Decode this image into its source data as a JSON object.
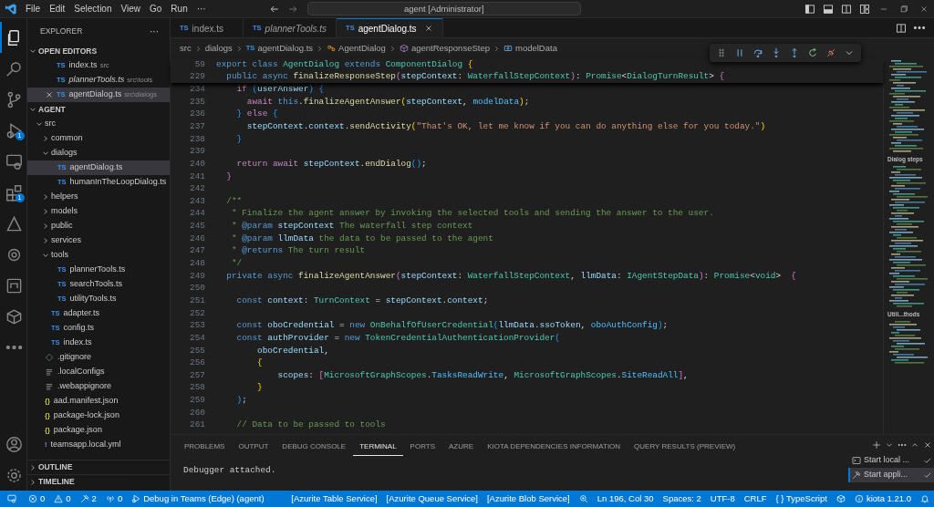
{
  "title_bar": {
    "menu": [
      "File",
      "Edit",
      "Selection",
      "View",
      "Go",
      "Run",
      "···"
    ],
    "command_center": "agent [Administrator]"
  },
  "activity_bar": {
    "top": [
      {
        "kind": "files",
        "selected": true
      },
      {
        "kind": "search",
        "selected": false
      },
      {
        "kind": "branch",
        "selected": false
      },
      {
        "kind": "debug",
        "selected": false,
        "badge": "1"
      },
      {
        "kind": "remote",
        "selected": false
      },
      {
        "kind": "extensions",
        "selected": false,
        "badge": "1"
      },
      {
        "kind": "azure",
        "selected": false
      },
      {
        "kind": "teams",
        "selected": false
      },
      {
        "kind": "m365",
        "selected": false
      },
      {
        "kind": "box",
        "selected": false
      },
      {
        "kind": "more",
        "selected": false
      }
    ],
    "bottom": [
      {
        "kind": "account",
        "selected": false
      },
      {
        "kind": "settings",
        "selected": false
      }
    ]
  },
  "sidebar": {
    "title": "EXPLORER",
    "actions": "···",
    "open_editors": {
      "label": "OPEN EDITORS",
      "expanded": true,
      "items": [
        {
          "glyph": "TS",
          "kind": "ts",
          "name": "index.ts",
          "detail": "src",
          "preview": false,
          "selected": false
        },
        {
          "glyph": "TS",
          "kind": "ts",
          "name": "plannerTools.ts",
          "detail": "src\\tools",
          "preview": true,
          "selected": false
        },
        {
          "glyph": "TS",
          "kind": "ts",
          "name": "agentDialog.ts",
          "detail": "src\\dialogs",
          "preview": false,
          "selected": true
        }
      ]
    },
    "folder": {
      "label": "AGENT",
      "expanded": true,
      "children": [
        {
          "name": "src",
          "expanded": true,
          "children": [
            {
              "name": "common",
              "expanded": false
            },
            {
              "name": "dialogs",
              "expanded": true,
              "children": [
                {
                  "glyph": "TS",
                  "kind": "ts",
                  "name": "agentDialog.ts",
                  "selected": true
                },
                {
                  "glyph": "TS",
                  "kind": "ts",
                  "name": "humanInTheLoopDialog.ts",
                  "selected": false
                }
              ]
            },
            {
              "name": "helpers",
              "expanded": false
            },
            {
              "name": "models",
              "expanded": false
            },
            {
              "name": "public",
              "expanded": false
            },
            {
              "name": "services",
              "expanded": false
            },
            {
              "name": "tools",
              "expanded": true,
              "children": [
                {
                  "glyph": "TS",
                  "kind": "ts",
                  "name": "plannerTools.ts",
                  "selected": false
                },
                {
                  "glyph": "TS",
                  "kind": "ts",
                  "name": "searchTools.ts",
                  "selected": false
                },
                {
                  "glyph": "TS",
                  "kind": "ts",
                  "name": "utilityTools.ts",
                  "selected": false
                }
              ]
            },
            {
              "glyph": "TS",
              "kind": "ts",
              "name": "adapter.ts",
              "selected": false
            },
            {
              "glyph": "TS",
              "kind": "ts",
              "name": "config.ts",
              "selected": false
            },
            {
              "glyph": "TS",
              "kind": "ts",
              "name": "index.ts",
              "selected": false
            }
          ]
        },
        {
          "kind": "git",
          "name": ".gitignore",
          "selected": false
        },
        {
          "kind": "config",
          "name": ".localConfigs",
          "selected": false
        },
        {
          "kind": "config",
          "name": ".webappignore",
          "selected": false
        },
        {
          "glyph": "{}",
          "kind": "json",
          "name": "aad.manifest.json",
          "selected": false
        },
        {
          "glyph": "{}",
          "kind": "json",
          "name": "package-lock.json",
          "selected": false
        },
        {
          "glyph": "{}",
          "kind": "json",
          "name": "package.json",
          "selected": false
        },
        {
          "glyph": "!",
          "kind": "yml",
          "name": "teamsapp.local.yml",
          "selected": false
        }
      ]
    },
    "collapsed_sections": [
      {
        "label": "OUTLINE",
        "expanded": false
      },
      {
        "label": "TIMELINE",
        "expanded": false
      }
    ]
  },
  "editor_tabs": [
    {
      "glyph": "TS",
      "name": "index.ts",
      "preview": false,
      "selected": false
    },
    {
      "glyph": "TS",
      "name": "plannerTools.ts",
      "preview": true,
      "selected": false
    },
    {
      "glyph": "TS",
      "name": "agentDialog.ts",
      "preview": false,
      "selected": true
    }
  ],
  "breadcrumb": [
    {
      "text": "src"
    },
    {
      "text": "dialogs"
    },
    {
      "glyph": "TS",
      "text": "agentDialog.ts"
    },
    {
      "kind": "class",
      "text": "AgentDialog"
    },
    {
      "kind": "method",
      "text": "agentResponseStep"
    },
    {
      "kind": "variable",
      "text": "modelData"
    }
  ],
  "editor": {
    "sticky": [
      {
        "n": "59",
        "tokens": [
          {
            "text": "export ",
            "kind": "kw"
          },
          {
            "text": "class ",
            "kind": "kw"
          },
          {
            "text": "AgentDialog ",
            "kind": "type"
          },
          {
            "text": "extends ",
            "kind": "kw"
          },
          {
            "text": "ComponentDialog ",
            "kind": "type"
          },
          {
            "text": "{",
            "kind": "b1"
          }
        ]
      },
      {
        "n": "229",
        "tokens": [
          {
            "text": "  public async ",
            "kind": "kw"
          },
          {
            "text": "finalizeResponseStep",
            "kind": "fn"
          },
          {
            "text": "(",
            "kind": "b2"
          },
          {
            "text": "stepContext",
            "kind": "var"
          },
          {
            "text": ": ",
            "kind": "punc"
          },
          {
            "text": "WaterfallStepContext",
            "kind": "type"
          },
          {
            "text": ")",
            "kind": "b2"
          },
          {
            "text": ": ",
            "kind": "punc"
          },
          {
            "text": "Promise",
            "kind": "type"
          },
          {
            "text": "<",
            "kind": "punc"
          },
          {
            "text": "DialogTurnResult",
            "kind": "type"
          },
          {
            "text": "> ",
            "kind": "punc"
          },
          {
            "text": "{",
            "kind": "b2"
          }
        ]
      }
    ],
    "lines": [
      {
        "n": "234",
        "tokens": [
          {
            "text": "    if ",
            "kind": "ctl"
          },
          {
            "text": "(",
            "kind": "b3"
          },
          {
            "text": "userAnswer",
            "kind": "var"
          },
          {
            "text": ") ",
            "kind": "b3"
          },
          {
            "text": "{",
            "kind": "b3"
          }
        ]
      },
      {
        "n": "235",
        "tokens": [
          {
            "text": "      await ",
            "kind": "ctl"
          },
          {
            "text": "this",
            "kind": "kw"
          },
          {
            "text": ".",
            "kind": "punc"
          },
          {
            "text": "finalizeAgentAnswer",
            "kind": "fn"
          },
          {
            "text": "(",
            "kind": "b1"
          },
          {
            "text": "stepContext",
            "kind": "var"
          },
          {
            "text": ", ",
            "kind": "punc"
          },
          {
            "text": "modelData",
            "kind": "const"
          },
          {
            "text": ")",
            "kind": "b1"
          },
          {
            "text": ";",
            "kind": "punc"
          }
        ]
      },
      {
        "n": "236",
        "tokens": [
          {
            "text": "    } ",
            "kind": "b3"
          },
          {
            "text": "else ",
            "kind": "ctl"
          },
          {
            "text": "{",
            "kind": "b3"
          }
        ]
      },
      {
        "n": "237",
        "tokens": [
          {
            "text": "      stepContext",
            "kind": "var"
          },
          {
            "text": ".",
            "kind": "punc"
          },
          {
            "text": "context",
            "kind": "var"
          },
          {
            "text": ".",
            "kind": "punc"
          },
          {
            "text": "sendActivity",
            "kind": "fn"
          },
          {
            "text": "(",
            "kind": "b1"
          },
          {
            "text": "\"That's OK, let me know if you can do anything else for you today.\"",
            "kind": "str"
          },
          {
            "text": ")",
            "kind": "b1"
          }
        ]
      },
      {
        "n": "238",
        "tokens": [
          {
            "text": "    }",
            "kind": "b3"
          }
        ]
      },
      {
        "n": "239"
      },
      {
        "n": "240",
        "tokens": [
          {
            "text": "    return await ",
            "kind": "ctl"
          },
          {
            "text": "stepContext",
            "kind": "var"
          },
          {
            "text": ".",
            "kind": "punc"
          },
          {
            "text": "endDialog",
            "kind": "fn"
          },
          {
            "text": "()",
            "kind": "b3"
          },
          {
            "text": ";",
            "kind": "punc"
          }
        ]
      },
      {
        "n": "241",
        "tokens": [
          {
            "text": "  }",
            "kind": "b2"
          }
        ]
      },
      {
        "n": "242"
      },
      {
        "n": "243",
        "tokens": [
          {
            "text": "  /**",
            "kind": "cmt"
          }
        ]
      },
      {
        "n": "244",
        "tokens": [
          {
            "text": "   * Finalize the agent answer by invoking the selected tools and sending the answer to the user.",
            "kind": "cmt"
          }
        ]
      },
      {
        "n": "245",
        "tokens": [
          {
            "text": "   * ",
            "kind": "cmt"
          },
          {
            "text": "@param ",
            "kind": "kw"
          },
          {
            "text": "stepContext ",
            "kind": "var"
          },
          {
            "text": "The waterfall step context",
            "kind": "cmt"
          }
        ]
      },
      {
        "n": "246",
        "tokens": [
          {
            "text": "   * ",
            "kind": "cmt"
          },
          {
            "text": "@param ",
            "kind": "kw"
          },
          {
            "text": "llmData ",
            "kind": "var"
          },
          {
            "text": "the data to be passed to the agent",
            "kind": "cmt"
          }
        ]
      },
      {
        "n": "247",
        "tokens": [
          {
            "text": "   * ",
            "kind": "cmt"
          },
          {
            "text": "@returns ",
            "kind": "kw"
          },
          {
            "text": "The turn result",
            "kind": "cmt"
          }
        ]
      },
      {
        "n": "248",
        "tokens": [
          {
            "text": "   */",
            "kind": "cmt"
          }
        ]
      },
      {
        "n": "249",
        "tokens": [
          {
            "text": "  private async ",
            "kind": "kw"
          },
          {
            "text": "finalizeAgentAnswer",
            "kind": "fn"
          },
          {
            "text": "(",
            "kind": "b2"
          },
          {
            "text": "stepContext",
            "kind": "var"
          },
          {
            "text": ": ",
            "kind": "punc"
          },
          {
            "text": "WaterfallStepContext",
            "kind": "type"
          },
          {
            "text": ", ",
            "kind": "punc"
          },
          {
            "text": "llmData",
            "kind": "var"
          },
          {
            "text": ": ",
            "kind": "punc"
          },
          {
            "text": "IAgentStepData",
            "kind": "type"
          },
          {
            "text": ")",
            "kind": "b2"
          },
          {
            "text": ": ",
            "kind": "punc"
          },
          {
            "text": "Promise",
            "kind": "type"
          },
          {
            "text": "<",
            "kind": "punc"
          },
          {
            "text": "void",
            "kind": "type"
          },
          {
            "text": ">  ",
            "kind": "punc"
          },
          {
            "text": "{",
            "kind": "b2"
          }
        ]
      },
      {
        "n": "250"
      },
      {
        "n": "251",
        "tokens": [
          {
            "text": "    const ",
            "kind": "kw"
          },
          {
            "text": "context",
            "kind": "var"
          },
          {
            "text": ": ",
            "kind": "punc"
          },
          {
            "text": "TurnContext",
            "kind": "type"
          },
          {
            "text": " = ",
            "kind": "punc"
          },
          {
            "text": "stepContext",
            "kind": "var"
          },
          {
            "text": ".",
            "kind": "punc"
          },
          {
            "text": "context",
            "kind": "var"
          },
          {
            "text": ";",
            "kind": "punc"
          }
        ]
      },
      {
        "n": "252"
      },
      {
        "n": "253",
        "tokens": [
          {
            "text": "    const ",
            "kind": "kw"
          },
          {
            "text": "oboCredential",
            "kind": "var"
          },
          {
            "text": " = ",
            "kind": "punc"
          },
          {
            "text": "new ",
            "kind": "kw"
          },
          {
            "text": "OnBehalfOfUserCredential",
            "kind": "type"
          },
          {
            "text": "(",
            "kind": "b3"
          },
          {
            "text": "llmData",
            "kind": "var"
          },
          {
            "text": ".",
            "kind": "punc"
          },
          {
            "text": "ssoToken",
            "kind": "var"
          },
          {
            "text": ", ",
            "kind": "punc"
          },
          {
            "text": "oboAuthConfig",
            "kind": "const"
          },
          {
            "text": ")",
            "kind": "b3"
          },
          {
            "text": ";",
            "kind": "punc"
          }
        ]
      },
      {
        "n": "254",
        "tokens": [
          {
            "text": "    const ",
            "kind": "kw"
          },
          {
            "text": "authProvider",
            "kind": "var"
          },
          {
            "text": " = ",
            "kind": "punc"
          },
          {
            "text": "new ",
            "kind": "kw"
          },
          {
            "text": "TokenCredentialAuthenticationProvider",
            "kind": "type"
          },
          {
            "text": "(",
            "kind": "b3"
          }
        ]
      },
      {
        "n": "255",
        "tokens": [
          {
            "text": "        oboCredential",
            "kind": "var"
          },
          {
            "text": ",",
            "kind": "punc"
          }
        ]
      },
      {
        "n": "256",
        "tokens": [
          {
            "text": "        {",
            "kind": "b1"
          }
        ]
      },
      {
        "n": "257",
        "tokens": [
          {
            "text": "            scopes",
            "kind": "var"
          },
          {
            "text": ": ",
            "kind": "punc"
          },
          {
            "text": "[",
            "kind": "b2"
          },
          {
            "text": "MicrosoftGraphScopes",
            "kind": "type"
          },
          {
            "text": ".",
            "kind": "punc"
          },
          {
            "text": "TasksReadWrite",
            "kind": "const"
          },
          {
            "text": ", ",
            "kind": "punc"
          },
          {
            "text": "MicrosoftGraphScopes",
            "kind": "type"
          },
          {
            "text": ".",
            "kind": "punc"
          },
          {
            "text": "SiteReadAll",
            "kind": "const"
          },
          {
            "text": "]",
            "kind": "b2"
          },
          {
            "text": ",",
            "kind": "punc"
          }
        ]
      },
      {
        "n": "258",
        "tokens": [
          {
            "text": "        }",
            "kind": "b1"
          }
        ]
      },
      {
        "n": "259",
        "tokens": [
          {
            "text": "    )",
            "kind": "b3"
          },
          {
            "text": ";",
            "kind": "punc"
          }
        ]
      },
      {
        "n": "260"
      },
      {
        "n": "261",
        "tokens": [
          {
            "text": "    // Data to be passed to tools",
            "kind": "cmt"
          }
        ]
      }
    ]
  },
  "minimap": {
    "sections": [
      "Dialog steps",
      "Utili...thods"
    ]
  },
  "panel": {
    "tabs": [
      {
        "label": "PROBLEMS",
        "selected": false
      },
      {
        "label": "OUTPUT",
        "selected": false
      },
      {
        "label": "DEBUG CONSOLE",
        "selected": false
      },
      {
        "label": "TERMINAL",
        "selected": true
      },
      {
        "label": "PORTS",
        "selected": false
      },
      {
        "label": "AZURE",
        "selected": false
      },
      {
        "label": "KIOTA DEPENDENCIES INFORMATION",
        "selected": false
      },
      {
        "label": "QUERY RESULTS (PREVIEW)",
        "selected": false
      }
    ],
    "terminal_output": "Debugger attached.",
    "terminals": [
      {
        "kind": "terminal",
        "text": "Start local ...",
        "selected": false
      },
      {
        "kind": "tools",
        "text": "Start appli...",
        "selected": true
      }
    ]
  },
  "status_bar": {
    "left": [
      {
        "kind": "remote"
      },
      {
        "kind": "error",
        "text": "0"
      },
      {
        "kind": "warning",
        "text": "0"
      },
      {
        "kind": "tools",
        "text": "2"
      },
      {
        "kind": "broadcast",
        "text": "0"
      },
      {
        "kind": "debug",
        "text": "Debug in Teams (Edge) (agent)"
      }
    ],
    "right": [
      {
        "text": "[Azurite Table Service]"
      },
      {
        "text": "[Azurite Queue Service]"
      },
      {
        "text": "[Azurite Blob Service]"
      },
      {
        "kind": "zoom"
      },
      {
        "text": "Ln 196, Col 30"
      },
      {
        "text": "Spaces: 2"
      },
      {
        "text": "UTF-8"
      },
      {
        "text": "CRLF"
      },
      {
        "text": "{ } TypeScript"
      },
      {
        "kind": "box"
      },
      {
        "kind": "info",
        "text": "kiota 1.21.0"
      },
      {
        "kind": "bell"
      }
    ]
  }
}
